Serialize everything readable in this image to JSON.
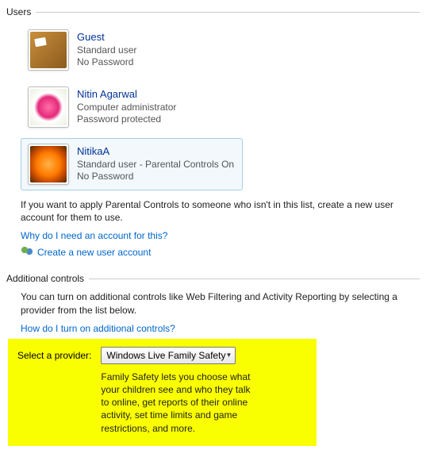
{
  "sections": {
    "users": {
      "title": "Users",
      "accounts": [
        {
          "name": "Guest",
          "role": "Standard user",
          "password": "No Password",
          "avatar": "guest",
          "selected": false
        },
        {
          "name": "Nitin Agarwal",
          "role": "Computer administrator",
          "password": "Password protected",
          "avatar": "nitin",
          "selected": false
        },
        {
          "name": "NitikaA",
          "role": "Standard user - Parental Controls On",
          "password": "No Password",
          "avatar": "nitika",
          "selected": true
        }
      ],
      "hint": "If you want to apply Parental Controls to someone who isn't in this list, create a new user account for them to use.",
      "link_why": "Why do I need an account for this?",
      "link_create": "Create a new user account"
    },
    "additional": {
      "title": "Additional controls",
      "description": "You can turn on additional controls like Web Filtering and Activity Reporting by selecting a provider from the list below.",
      "link_how": "How do I turn on additional controls?",
      "provider_label": "Select a provider:",
      "provider_selected": "Windows Live Family Safety",
      "provider_description": "Family Safety lets you choose what your children see and who they talk to online, get reports of their online activity, set time limits and game restrictions, and more."
    }
  }
}
